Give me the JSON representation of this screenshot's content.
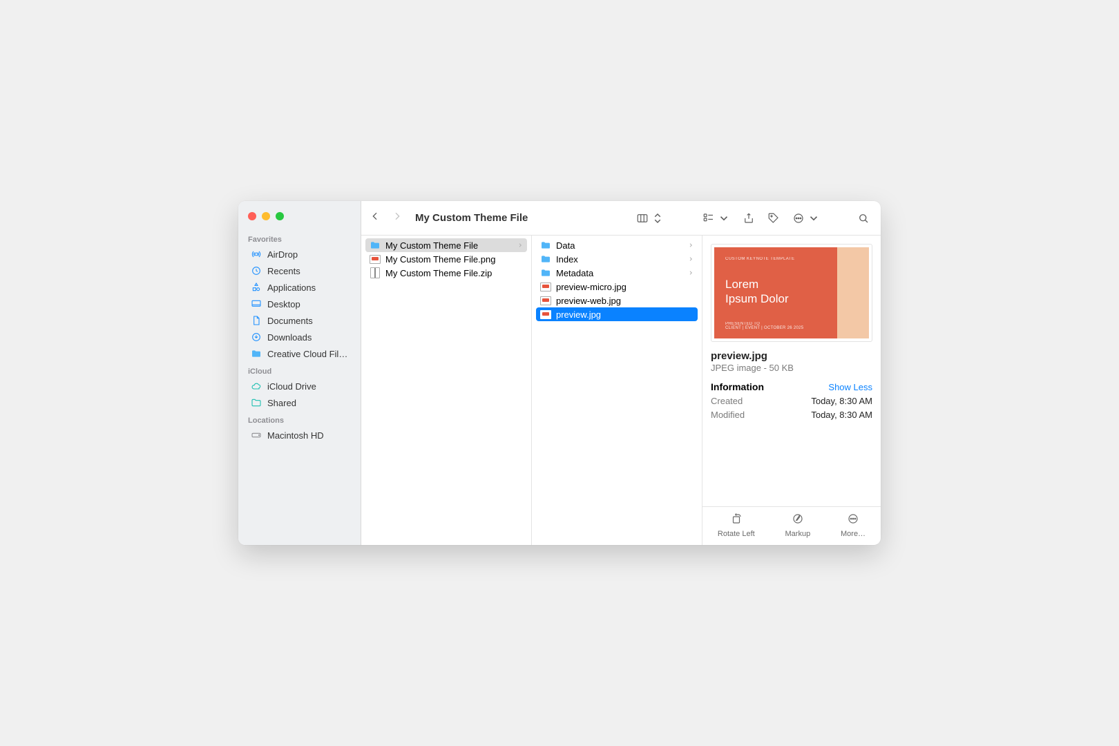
{
  "window": {
    "title": "My Custom Theme File"
  },
  "sidebar": {
    "sections": [
      {
        "header": "Favorites",
        "items": [
          {
            "icon": "airdrop-icon",
            "label": "AirDrop"
          },
          {
            "icon": "clock-icon",
            "label": "Recents"
          },
          {
            "icon": "apps-icon",
            "label": "Applications"
          },
          {
            "icon": "desktop-icon",
            "label": "Desktop"
          },
          {
            "icon": "document-icon",
            "label": "Documents"
          },
          {
            "icon": "download-icon",
            "label": "Downloads"
          },
          {
            "icon": "folder-icon",
            "label": "Creative Cloud Fil…"
          }
        ]
      },
      {
        "header": "iCloud",
        "items": [
          {
            "icon": "cloud-icon",
            "label": "iCloud Drive"
          },
          {
            "icon": "shared-icon",
            "label": "Shared"
          }
        ]
      },
      {
        "header": "Locations",
        "items": [
          {
            "icon": "disk-icon",
            "label": "Macintosh HD"
          }
        ]
      }
    ]
  },
  "col1": [
    {
      "type": "folder",
      "name": "My Custom Theme File",
      "hasChildren": true,
      "selected": "gray"
    },
    {
      "type": "image",
      "name": "My Custom Theme File.png"
    },
    {
      "type": "zip",
      "name": "My Custom Theme File.zip"
    }
  ],
  "col2": [
    {
      "type": "folder",
      "name": "Data",
      "hasChildren": true
    },
    {
      "type": "folder",
      "name": "Index",
      "hasChildren": true
    },
    {
      "type": "folder",
      "name": "Metadata",
      "hasChildren": true
    },
    {
      "type": "image",
      "name": "preview-micro.jpg"
    },
    {
      "type": "image",
      "name": "preview-web.jpg"
    },
    {
      "type": "image",
      "name": "preview.jpg",
      "selected": "blue"
    }
  ],
  "preview": {
    "art": {
      "eyebrow": "CUSTOM KEYNOTE TEMPLATE",
      "headline": "Lorem\nIpsum Dolor",
      "footer": "PRESENTED TO\nCLIENT | EVENT | OCTOBER 26 2025"
    },
    "filename": "preview.jpg",
    "subtitle": "JPEG image - 50 KB",
    "info_label": "Information",
    "show_less": "Show Less",
    "rows": [
      {
        "label": "Created",
        "value": "Today, 8:30 AM"
      },
      {
        "label": "Modified",
        "value": "Today, 8:30 AM"
      }
    ],
    "actions": [
      {
        "icon": "rotate-icon",
        "label": "Rotate Left"
      },
      {
        "icon": "markup-icon",
        "label": "Markup"
      },
      {
        "icon": "more-icon",
        "label": "More…"
      }
    ]
  }
}
